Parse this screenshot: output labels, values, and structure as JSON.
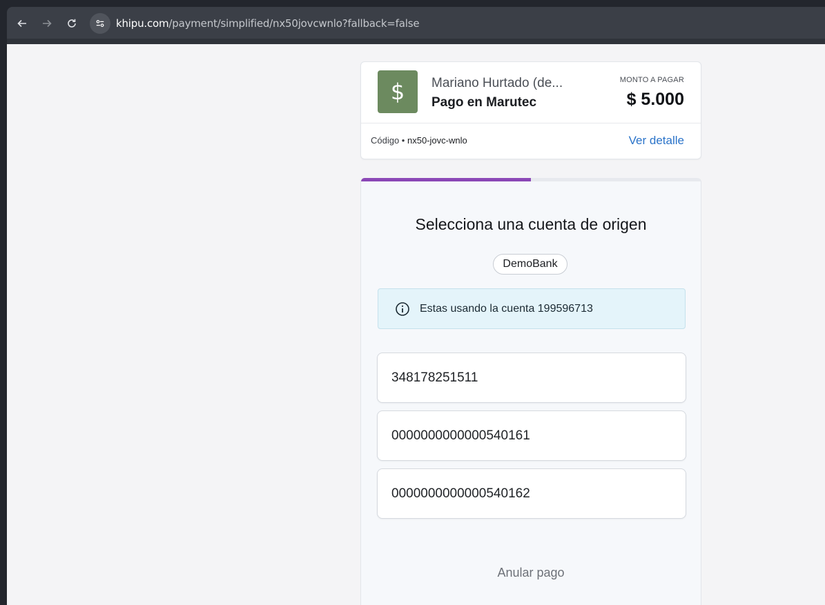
{
  "browser": {
    "url_host": "khipu.com",
    "url_path": "/payment/simplified/nx50jovcwnlo?fallback=false"
  },
  "header": {
    "logo_symbol": "$",
    "logo_color": "#6c8a5f",
    "merchant_name": "Mariano Hurtado (de...",
    "subject": "Pago en Marutec",
    "amount_label": "MONTO A PAGAR",
    "amount": "$ 5.000",
    "code_label": "Código • ",
    "code_value": "nx50-jovc-wnlo",
    "details_link": "Ver detalle",
    "link_color": "#2a73c9"
  },
  "progress": {
    "fraction": 0.5,
    "color": "#8b47b6"
  },
  "main": {
    "title": "Selecciona una cuenta de origen",
    "bank": "DemoBank",
    "info_icon": "info-icon",
    "info_text": "Estas usando la cuenta 199596713",
    "accounts": [
      "348178251511",
      "0000000000000540161",
      "0000000000000540162"
    ],
    "cancel_label": "Anular pago"
  }
}
